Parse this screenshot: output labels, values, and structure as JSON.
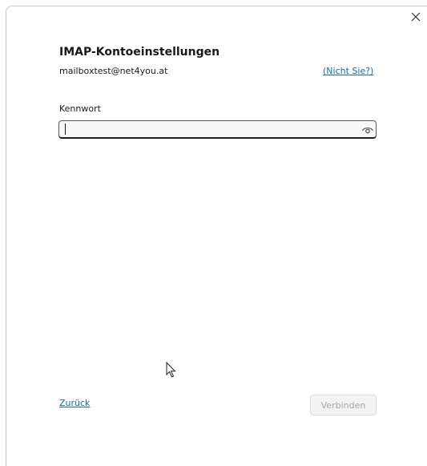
{
  "dialog": {
    "title": "IMAP-Kontoeinstellungen",
    "email": "mailboxtest@net4you.at",
    "not_you_link": "(Nicht Sie?)",
    "close_icon": "close-icon"
  },
  "password": {
    "label": "Kennwort",
    "value": "",
    "placeholder": "",
    "reveal_icon": "eye-icon"
  },
  "footer": {
    "back_link": "Zurück",
    "connect_label": "Verbinden",
    "connect_enabled": false
  },
  "colors": {
    "link": "#0f6cbd",
    "disabled_text": "#a6a6a6",
    "disabled_bg": "#f3f3f3"
  }
}
